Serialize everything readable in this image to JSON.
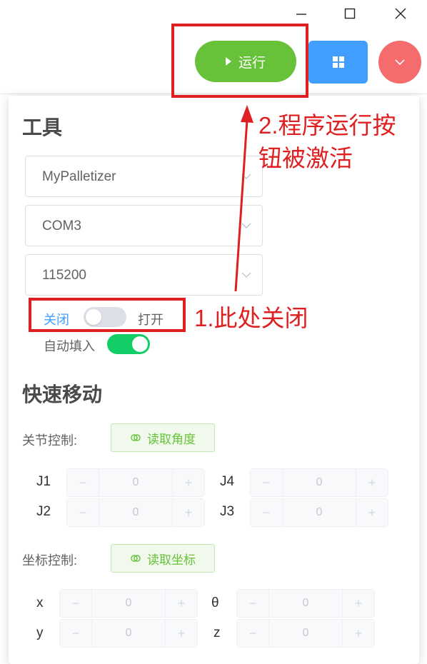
{
  "window": {
    "minimize_icon": "minimize-icon",
    "maximize_icon": "maximize-icon",
    "close_icon": "close-icon"
  },
  "toolbar": {
    "run_label": "运行",
    "run_color": "#67c23a",
    "grid_icon": "grid-icon",
    "grid_color": "#409eff",
    "menu_icon": "chevron-down-icon",
    "menu_color": "#f56c6c"
  },
  "tools": {
    "title": "工具",
    "device_select": "MyPalletizer",
    "port_select": "COM3",
    "baud_select": "115200",
    "connect_switch": {
      "off_label": "关闭",
      "on_label": "打开",
      "state": "off"
    },
    "auto_fill": {
      "label": "自动填入",
      "state": "on"
    }
  },
  "quick_move": {
    "title": "快速移动",
    "joint_control_label": "关节控制:",
    "read_angle_label": "读取角度",
    "joints": [
      {
        "name": "J1",
        "value": "0"
      },
      {
        "name": "J4",
        "value": "0"
      },
      {
        "name": "J2",
        "value": "0"
      },
      {
        "name": "J3",
        "value": "0"
      }
    ],
    "coord_control_label": "坐标控制:",
    "read_coord_label": "读取坐标",
    "coords": [
      {
        "name": "x",
        "value": "0"
      },
      {
        "name": "θ",
        "value": "0"
      },
      {
        "name": "y",
        "value": "0"
      },
      {
        "name": "z",
        "value": "0"
      }
    ],
    "stepper_minus": "−",
    "stepper_plus": "+"
  },
  "annotations": {
    "step1": "1.此处关闭",
    "step2_line1": "2.程序运行按",
    "step2_line2": "钮被激活",
    "color": "#e02020"
  }
}
